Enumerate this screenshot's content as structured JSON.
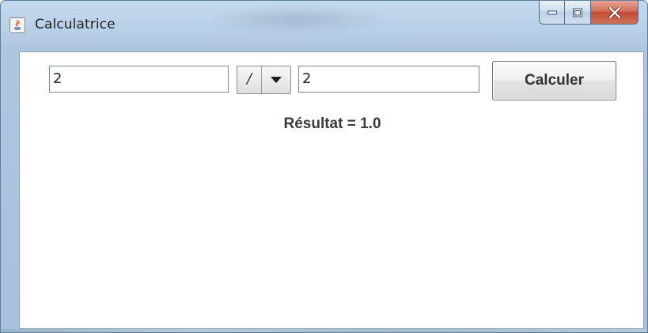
{
  "window": {
    "title": "Calculatrice",
    "app_icon": "java-icon",
    "caption_buttons": {
      "minimize_icon": "minimize-icon",
      "maximize_icon": "maximize-icon",
      "close_icon": "close-icon"
    }
  },
  "form": {
    "operand_left": "2",
    "operator": "/",
    "operator_dropdown_icon": "dropdown-arrow-icon",
    "operand_right": "2",
    "calculate_label": "Calculer"
  },
  "result": {
    "text": "Résultat = 1.0"
  },
  "colors": {
    "titlebar": "#b9d1e8",
    "close_button": "#c94d35",
    "client_background": "#ffffff"
  }
}
